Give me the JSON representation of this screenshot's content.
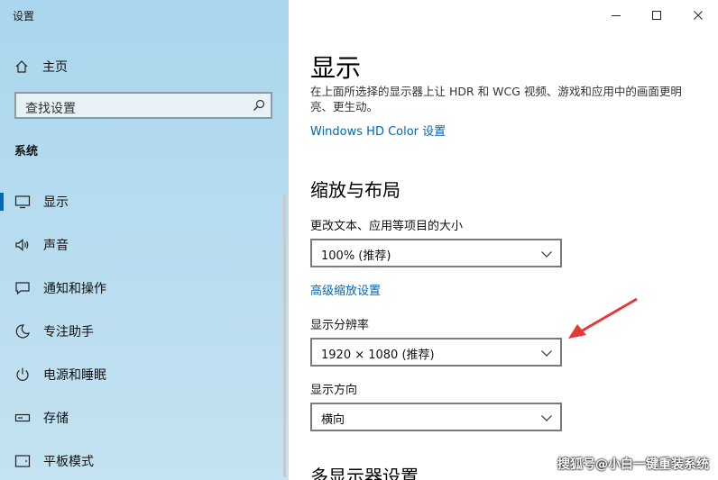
{
  "window": {
    "title": "设置"
  },
  "sidebar": {
    "home_label": "主页",
    "search_placeholder": "查找设置",
    "section": "系统",
    "items": [
      {
        "label": "显示",
        "icon": "monitor-icon",
        "active": true
      },
      {
        "label": "声音",
        "icon": "speaker-icon"
      },
      {
        "label": "通知和操作",
        "icon": "notification-icon"
      },
      {
        "label": "专注助手",
        "icon": "moon-icon"
      },
      {
        "label": "电源和睡眠",
        "icon": "power-icon"
      },
      {
        "label": "存储",
        "icon": "storage-icon"
      },
      {
        "label": "平板模式",
        "icon": "tablet-icon"
      }
    ]
  },
  "main": {
    "title": "显示",
    "description": "在上面所选择的显示器上让 HDR 和 WCG 视频、游戏和应用中的画面更明亮、更生动。",
    "hdr_link": "Windows HD Color 设置",
    "scale_heading": "缩放与布局",
    "scale_label": "更改文本、应用等项目的大小",
    "scale_value": "100% (推荐)",
    "advanced_scale_link": "高级缩放设置",
    "resolution_label": "显示分辨率",
    "resolution_value": "1920 × 1080 (推荐)",
    "orientation_label": "显示方向",
    "orientation_value": "横向",
    "multi_display_heading": "多显示器设置"
  },
  "colors": {
    "accent": "#0067c0",
    "link": "#0066b4",
    "annotation_arrow": "#e53935"
  },
  "watermark": "搜狐号@小白一键重装系统"
}
